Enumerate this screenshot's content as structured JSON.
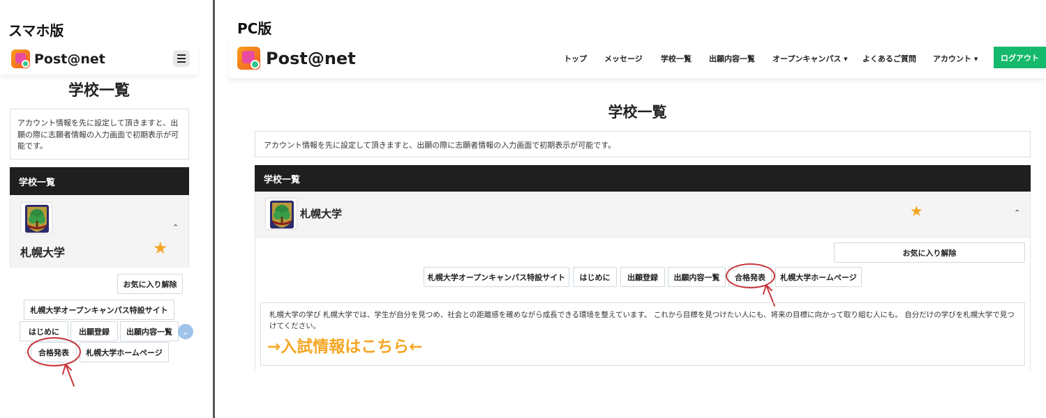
{
  "captions": {
    "sp": "スマホ版",
    "pc": "PC版"
  },
  "brand": {
    "name": "Post@net"
  },
  "page_title": "学校一覧",
  "notice": "アカウント情報を先に設定して頂きますと、出願の際に志願者情報の入力画面で初期表示が可能です。",
  "list_header": "学校一覧",
  "school": {
    "name": "札幌大学",
    "favorite_remove": "お気に入り解除",
    "buttons": {
      "open_campus": "札幌大学オープンキャンパス特設サイト",
      "intro": "はじめに",
      "registration": "出願登録",
      "application_list": "出願内容一覧",
      "results": "合格発表",
      "homepage": "札幌大学ホームページ"
    },
    "description": "札幌大学の学び 札幌大学では、学生が自分を見つめ、社会との距離感を確めながら成長できる環境を整えています。 これから目標を見つけたい人にも、将来の目標に向かって取り組む人にも。 自分だけの学びを札幌大学で見つけてください。",
    "entrance_link": "→入試情報はこちら←"
  },
  "nav": {
    "top": "トップ",
    "message": "メッセージ",
    "schools": "学校一覧",
    "applications": "出願内容一覧",
    "open_campus": "オープンキャンパス ▾",
    "faq": "よくあるご質問",
    "account": "アカウント ▾",
    "logout": "ログアウト"
  },
  "colors": {
    "accent_star": "#f5a623",
    "logout_green": "#15b96b",
    "annotation_red": "#c8333a",
    "header_dark": "#1f1f1f"
  },
  "icons": {
    "menu": "hamburger-icon",
    "favorite": "star-icon",
    "collapse": "chevron-up-icon",
    "scroll": "chevron-down-icon"
  }
}
